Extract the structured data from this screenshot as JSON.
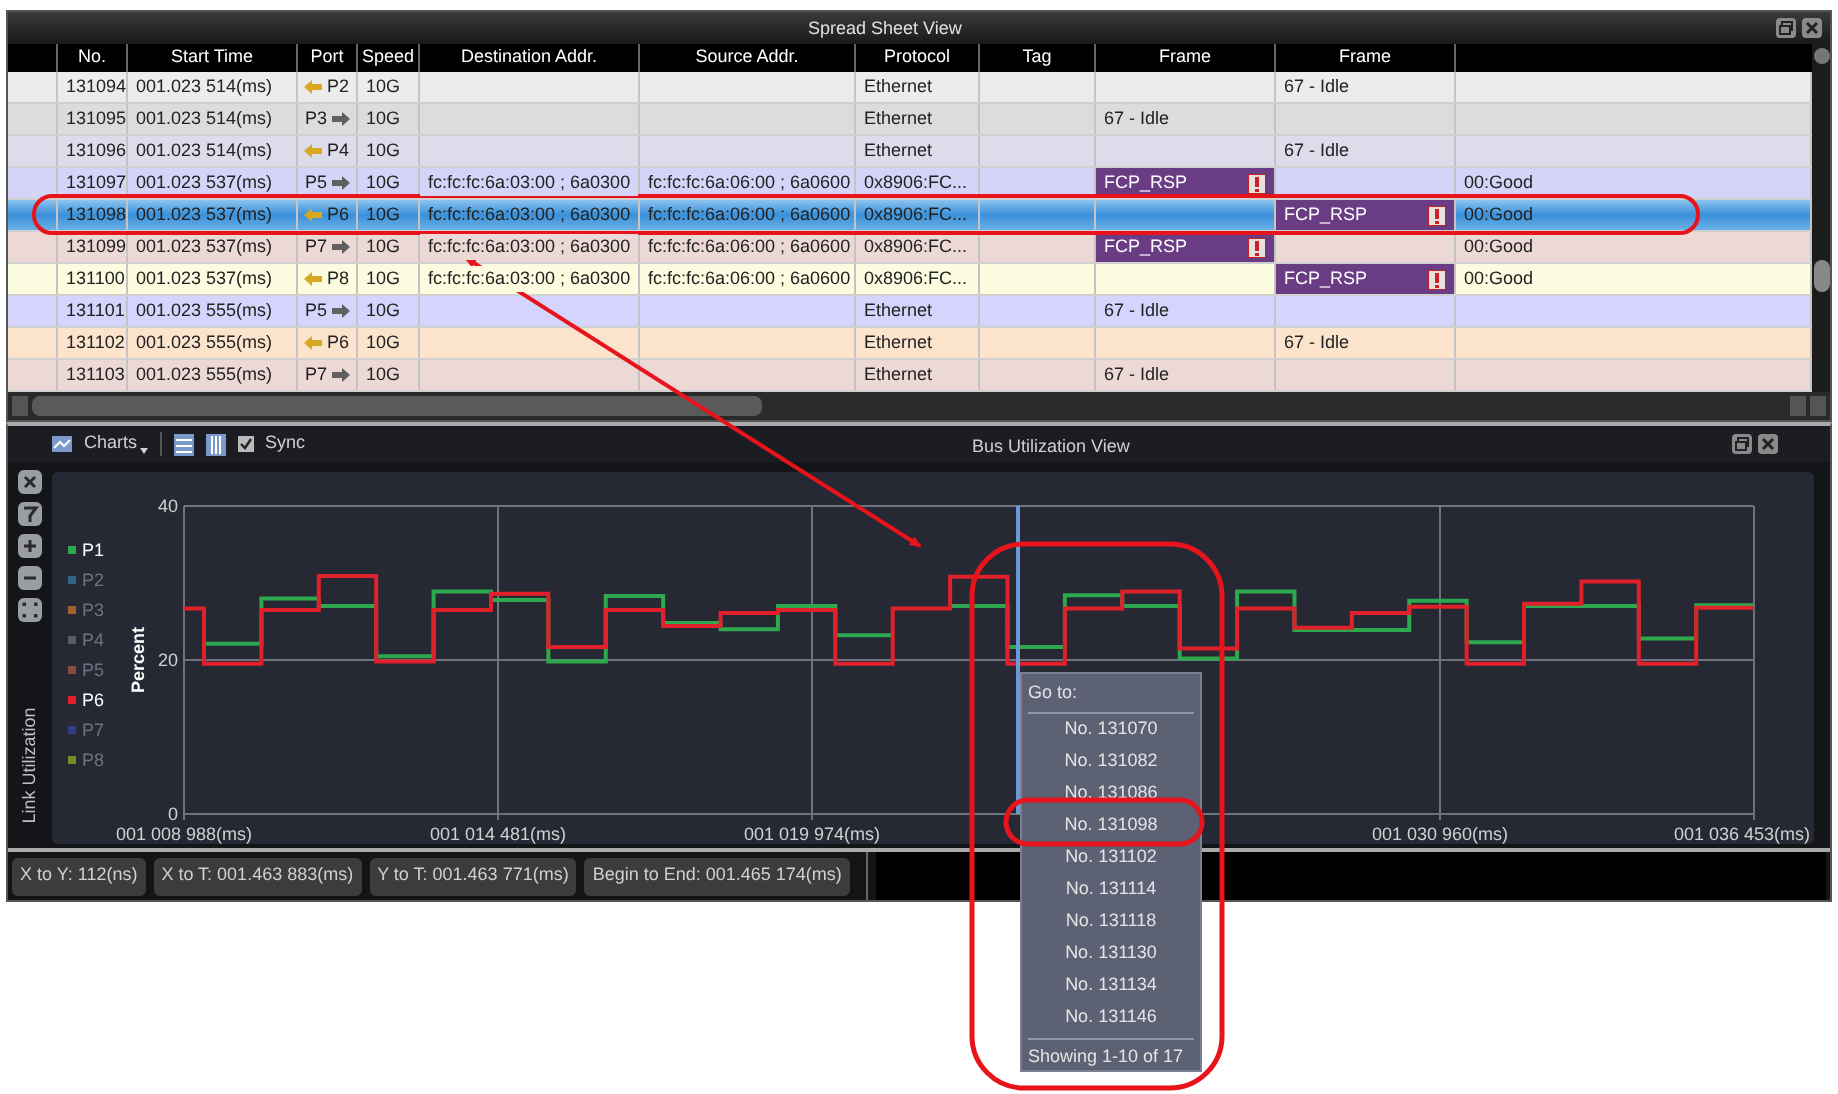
{
  "spreadsheet": {
    "title": "Spread Sheet View",
    "columns": [
      "No.",
      "Start Time",
      "Port",
      "Speed",
      "Destination Addr.",
      "Source Addr.",
      "Protocol",
      "Tag",
      "Frame",
      "Frame"
    ],
    "rows": [
      {
        "no": "131094",
        "start_time": "001.023 514(ms)",
        "port": "P2",
        "kind": "inbound",
        "speed": "10G",
        "protocol": "Ethernet",
        "frame_2": {
          "text": "67 - Idle",
          "kind": "plain"
        },
        "color": "#ececec",
        "selected": false
      },
      {
        "no": "131095",
        "start_time": "001.023 514(ms)",
        "port": "P3",
        "kind": "outbound",
        "speed": "10G",
        "protocol": "Ethernet",
        "frame_1": {
          "text": "67 - Idle",
          "kind": "plain"
        },
        "color": "#dcdcdc",
        "selected": false
      },
      {
        "no": "131096",
        "start_time": "001.023 514(ms)",
        "port": "P4",
        "kind": "inbound",
        "speed": "10G",
        "protocol": "Ethernet",
        "frame_2": {
          "text": "67 - Idle",
          "kind": "plain"
        },
        "color": "#dcdcea",
        "selected": false
      },
      {
        "no": "131097",
        "start_time": "001.023 537(ms)",
        "port": "P5",
        "kind": "outbound",
        "speed": "10G",
        "destination": "fc:fc:fc:6a:03:00 ; 6a0300",
        "source": "fc:fc:fc:6a:06:00 ; 6a0600",
        "protocol": "0x8906:FC...",
        "frame_1": {
          "text": "FCP_RSP",
          "kind": "alert"
        },
        "column_12": "00:Good",
        "color": "#d4d4f8",
        "selected": false
      },
      {
        "no": "131098",
        "start_time": "001.023 537(ms)",
        "port": "P6",
        "kind": "inbound",
        "speed": "10G",
        "destination": "fc:fc:fc:6a:03:00 ; 6a0300",
        "source": "fc:fc:fc:6a:06:00 ; 6a0600",
        "protocol": "0x8906:FC...",
        "frame_2": {
          "text": "FCP_RSP",
          "kind": "alert"
        },
        "column_12": "00:Good",
        "selected": true
      },
      {
        "no": "131099",
        "start_time": "001.023 537(ms)",
        "port": "P7",
        "kind": "outbound",
        "speed": "10G",
        "destination": "fc:fc:fc:6a:03:00 ; 6a0300",
        "source": "fc:fc:fc:6a:06:00 ; 6a0600",
        "protocol": "0x8906:FC...",
        "frame_1": {
          "text": "FCP_RSP",
          "kind": "alert"
        },
        "column_12": "00:Good",
        "color": "#ecd8d4",
        "selected": false
      },
      {
        "no": "131100",
        "start_time": "001.023 537(ms)",
        "port": "P8",
        "kind": "inbound",
        "speed": "10G",
        "destination": "fc:fc:fc:6a:03:00 ; 6a0300",
        "source": "fc:fc:fc:6a:06:00 ; 6a0600",
        "protocol": "0x8906:FC...",
        "frame_2": {
          "text": "FCP_RSP",
          "kind": "alert"
        },
        "column_12": "00:Good",
        "color": "#fcfce0",
        "selected": false
      },
      {
        "no": "131101",
        "start_time": "001.023 555(ms)",
        "port": "P5",
        "kind": "outbound",
        "speed": "10G",
        "protocol": "Ethernet",
        "frame_1": {
          "text": "67 - Idle",
          "kind": "plain"
        },
        "color": "#d4d4fc",
        "selected": false
      },
      {
        "no": "131102",
        "start_time": "001.023 555(ms)",
        "port": "P6",
        "kind": "inbound",
        "speed": "10G",
        "protocol": "Ethernet",
        "frame_2": {
          "text": "67 - Idle",
          "kind": "plain"
        },
        "color": "#fce4cc",
        "selected": false
      },
      {
        "no": "131103",
        "start_time": "001.023 555(ms)",
        "port": "P7",
        "kind": "outbound",
        "speed": "10G",
        "protocol": "Ethernet",
        "frame_1": {
          "text": "67 - Idle",
          "kind": "plain"
        },
        "color": "#ecd8d4",
        "selected": false
      }
    ]
  },
  "bus_view": {
    "title": "Bus Utilization View",
    "charts_menu": "Charts",
    "sync": {
      "label": "Sync",
      "checked": true
    },
    "side_label": "Link Utilization",
    "chart_data": {
      "type": "line",
      "ylabel": "Percent",
      "grid": true,
      "legend": [
        {
          "kind": "series"
        },
        {
          "kind": "hidden",
          "name": "P2",
          "color": "#2f6688"
        },
        {
          "kind": "hidden",
          "name": "P3",
          "color": "#a0622a"
        },
        {
          "kind": "hidden",
          "name": "P4",
          "color": "#5e5e5e"
        },
        {
          "kind": "hidden",
          "name": "P5",
          "color": "#8a4a3a"
        },
        {
          "kind": "series"
        },
        {
          "kind": "hidden",
          "name": "P7",
          "color": "#343e8a"
        },
        {
          "kind": "hidden",
          "name": "P8",
          "color": "#7a8a2a"
        }
      ],
      "x": [
        1008988,
        1009338,
        1009338,
        1010342,
        1010342,
        1011346,
        1011346,
        1012350,
        1012350,
        1013354,
        1013354,
        1014358,
        1014358,
        1015362,
        1015362,
        1016366,
        1016366,
        1017370,
        1017370,
        1018374,
        1018374,
        1019378,
        1019378,
        1020382,
        1020382,
        1021386,
        1021386,
        1022390,
        1022390,
        1023394,
        1023394,
        1024398,
        1024398,
        1025402,
        1025402,
        1026406,
        1026406,
        1027410,
        1027410,
        1028414,
        1028414,
        1029418,
        1029418,
        1030422,
        1030422,
        1031426,
        1031426,
        1032430,
        1032430,
        1033434,
        1033434,
        1034438,
        1034438,
        1035442,
        1035442,
        1036453
      ],
      "series": [
        {
          "name": "P1",
          "color": "#2ea84f",
          "values": [
            null,
            null,
            22.1,
            22.1,
            28,
            28,
            27,
            27,
            20.5,
            20.5,
            28.9,
            28.9,
            27.8,
            27.8,
            19.8,
            19.8,
            28.3,
            28.3,
            24.8,
            24.8,
            24,
            24,
            27,
            27,
            23.2,
            23.2,
            null,
            null,
            27,
            27,
            21.7,
            21.7,
            28.4,
            28.4,
            27,
            27,
            20.2,
            20.2,
            28.9,
            28.9,
            23.9,
            23.9,
            23.9,
            23.9,
            27.7,
            27.7,
            22.3,
            22.3,
            27,
            27,
            27,
            27,
            22.8,
            22.8,
            27.1,
            27.1
          ]
        },
        {
          "name": "P6",
          "color": "#e0202a",
          "values": [
            26.7,
            26.7,
            19.5,
            19.5,
            26.5,
            26.5,
            30.9,
            30.9,
            19.8,
            19.8,
            26.5,
            26.5,
            28.6,
            28.6,
            21.7,
            21.7,
            26.5,
            26.5,
            24.4,
            24.4,
            26.1,
            26.1,
            26.5,
            26.5,
            19.5,
            19.5,
            26.7,
            26.7,
            30.8,
            30.8,
            19.5,
            19.5,
            26.7,
            26.7,
            28.9,
            28.9,
            21.5,
            21.5,
            26.7,
            26.7,
            24.2,
            24.2,
            26.1,
            26.1,
            26.9,
            26.9,
            19.5,
            19.5,
            27.3,
            27.3,
            30.2,
            30.2,
            19.5,
            19.5,
            26.8,
            26.8
          ]
        }
      ],
      "ref_lines": [
        {
          "axis": "x",
          "value": 1023578,
          "color": "#6a9ad8"
        }
      ],
      "xlim": [
        1008988,
        1036453
      ],
      "ylim": [
        0,
        40
      ],
      "xticks": [
        {
          "value": 1008988,
          "label": "001 008 988(ms)"
        },
        {
          "value": 1014481,
          "label": "001 014 481(ms)"
        },
        {
          "value": 1019974,
          "label": "001 019 974(ms)"
        },
        {
          "value": 1030960,
          "label": "001 030 960(ms)"
        },
        {
          "value": 1036453,
          "label": "001 036 453(ms)"
        }
      ],
      "yticks": [
        0,
        20,
        40
      ]
    }
  },
  "status_bar": [
    "X to Y: 112(ns)",
    "X to T: 001.463 883(ms)",
    "Y to T: 001.463 771(ms)",
    "Begin to End: 001.465 174(ms)"
  ],
  "goto_menu": {
    "title": "Go to:",
    "items": [
      {
        "label": "No. 131070",
        "selected": false
      },
      {
        "label": "No. 131082",
        "selected": false
      },
      {
        "label": "No. 131086",
        "selected": false
      },
      {
        "label": "No. 131098",
        "selected": false
      },
      {
        "label": "No. 131102",
        "selected": false
      },
      {
        "label": "No. 131114",
        "selected": false
      },
      {
        "label": "No. 131118",
        "selected": false
      },
      {
        "label": "No. 131130",
        "selected": false
      },
      {
        "label": "No. 131134",
        "selected": false
      },
      {
        "label": "No. 131146",
        "selected": false
      }
    ],
    "footer": "Showing 1-10 of 17"
  }
}
